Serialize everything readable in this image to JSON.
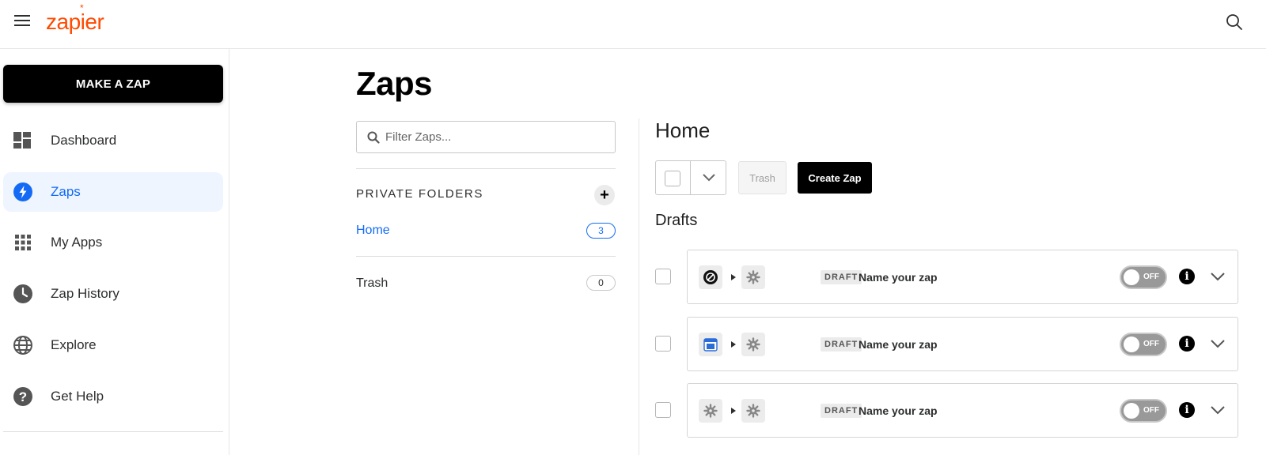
{
  "header": {
    "logo_text": "zapier",
    "logo_star": "*",
    "menu_icon": "hamburger-icon",
    "search_icon": "search-icon",
    "brand_color": "#ff4a00"
  },
  "sidebar": {
    "make_zap_label": "MAKE A ZAP",
    "items": [
      {
        "label": "Dashboard",
        "icon": "dashboard-icon",
        "active": false
      },
      {
        "label": "Zaps",
        "icon": "lightning-icon",
        "active": true
      },
      {
        "label": "My Apps",
        "icon": "apps-grid-icon",
        "active": false
      },
      {
        "label": "Zap History",
        "icon": "clock-icon",
        "active": false
      },
      {
        "label": "Explore",
        "icon": "globe-icon",
        "active": false
      },
      {
        "label": "Get Help",
        "icon": "help-icon",
        "active": false
      }
    ],
    "accent_color": "#136bf5"
  },
  "main": {
    "title": "Zaps",
    "filter_placeholder": "Filter Zaps...",
    "folders_heading": "PRIVATE FOLDERS",
    "add_folder_label": "+",
    "folders": [
      {
        "name": "Home",
        "count": "3",
        "active": true
      },
      {
        "name": "Trash",
        "count": "0",
        "active": false
      }
    ]
  },
  "content": {
    "title": "Home",
    "trash_label": "Trash",
    "create_label": "Create Zap",
    "drafts_title": "Drafts",
    "zaps": [
      {
        "trigger_icon": "zapier-app-icon",
        "action_icon": "gear-icon",
        "badge": "DRAFT",
        "name": "Name your zap",
        "toggle": "OFF",
        "info": "i"
      },
      {
        "trigger_icon": "google-calendar-icon",
        "action_icon": "gear-icon",
        "badge": "DRAFT",
        "name": "Name your zap",
        "toggle": "OFF",
        "info": "i"
      },
      {
        "trigger_icon": "gear-icon",
        "action_icon": "gear-icon",
        "badge": "DRAFT",
        "name": "Name your zap",
        "toggle": "OFF",
        "info": "i"
      }
    ]
  }
}
